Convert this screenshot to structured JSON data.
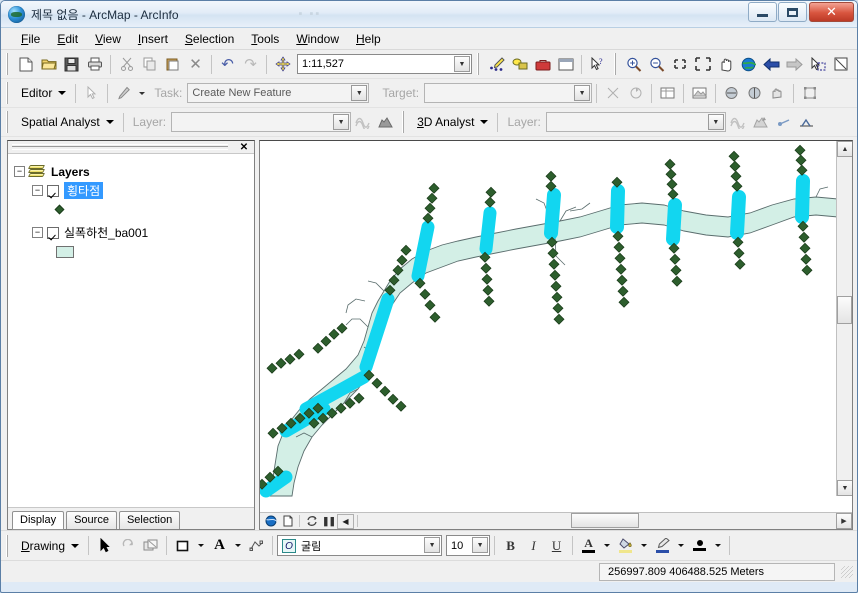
{
  "window": {
    "title": "제목 없음 - ArcMap - ArcInfo",
    "minimize_label": "Minimize",
    "maximize_label": "Maximize",
    "close_label": "✕"
  },
  "menubar": {
    "items": [
      {
        "label": "File",
        "accel": "F"
      },
      {
        "label": "Edit",
        "accel": "E"
      },
      {
        "label": "View",
        "accel": "V"
      },
      {
        "label": "Insert",
        "accel": "I"
      },
      {
        "label": "Selection",
        "accel": "S"
      },
      {
        "label": "Tools",
        "accel": "T"
      },
      {
        "label": "Window",
        "accel": "W"
      },
      {
        "label": "Help",
        "accel": "H"
      }
    ]
  },
  "standard_toolbar": {
    "scale_value": "1:11,527",
    "buttons": [
      {
        "name": "new-map-icon",
        "glyph": "🗋"
      },
      {
        "name": "open-map-icon",
        "glyph": "📂"
      },
      {
        "name": "save-map-icon",
        "glyph": "💾"
      },
      {
        "name": "print-icon",
        "glyph": "🖨"
      },
      {
        "name": "cut-icon",
        "glyph": "✂"
      },
      {
        "name": "copy-icon",
        "glyph": "⧉"
      },
      {
        "name": "paste-icon",
        "glyph": "📋"
      },
      {
        "name": "delete-icon",
        "glyph": "✕"
      },
      {
        "name": "undo-icon",
        "glyph": "↶"
      },
      {
        "name": "redo-icon",
        "glyph": "↷"
      },
      {
        "name": "add-data-icon",
        "glyph": "✜"
      }
    ],
    "right_buttons": [
      {
        "name": "editor-toolbar-icon",
        "glyph": "✎"
      },
      {
        "name": "model-builder-icon",
        "glyph": "⬟"
      },
      {
        "name": "toolbox-icon",
        "glyph": "🧰"
      },
      {
        "name": "command-line-icon",
        "glyph": "▭"
      },
      {
        "name": "whats-this-icon",
        "glyph": "↖?"
      },
      {
        "name": "zoom-in-icon",
        "glyph": "⊕"
      },
      {
        "name": "zoom-out-icon",
        "glyph": "⊖"
      },
      {
        "name": "fixed-zoom-in-icon",
        "glyph": "⤢"
      },
      {
        "name": "fixed-zoom-out-icon",
        "glyph": "⤡"
      },
      {
        "name": "pan-icon",
        "glyph": "✋"
      },
      {
        "name": "full-extent-icon",
        "glyph": "🌐"
      },
      {
        "name": "go-back-extent-icon",
        "glyph": "⬅"
      },
      {
        "name": "go-forward-extent-icon",
        "glyph": "➡"
      },
      {
        "name": "select-features-icon",
        "glyph": "↖"
      },
      {
        "name": "clear-selection-icon",
        "glyph": "⊠"
      }
    ]
  },
  "editor_toolbar": {
    "menu_label": "Editor",
    "task_label": "Task:",
    "task_value": "Create New Feature",
    "target_label": "Target:",
    "target_value": "",
    "buttons": [
      {
        "name": "edit-tool-icon",
        "glyph": "↖"
      },
      {
        "name": "sketch-tool-icon",
        "glyph": "✎"
      },
      {
        "name": "split-tool-icon",
        "glyph": "✂"
      },
      {
        "name": "rotate-tool-icon",
        "glyph": "⟳"
      },
      {
        "name": "attributes-icon",
        "glyph": "▤"
      },
      {
        "name": "sketch-properties-icon",
        "glyph": "◲"
      },
      {
        "name": "create-new-feature-icon",
        "glyph": "◉"
      },
      {
        "name": "edit-annotation-icon",
        "glyph": "◎"
      },
      {
        "name": "construct-features-icon",
        "glyph": "✍"
      },
      {
        "name": "topology-icon",
        "glyph": "⬚"
      }
    ]
  },
  "spatial_analyst_toolbar": {
    "menu_label": "Spatial Analyst",
    "layer_label": "Layer:",
    "layer_value": "",
    "buttons": [
      {
        "name": "histogram-icon",
        "glyph": "≋"
      },
      {
        "name": "surface-icon",
        "glyph": "◣"
      }
    ]
  },
  "analyst3d_toolbar": {
    "menu_label": "3D Analyst",
    "layer_label": "Layer:",
    "layer_value": "",
    "buttons": [
      {
        "name": "contour-icon",
        "glyph": "≋"
      },
      {
        "name": "steepest-path-icon",
        "glyph": "↘"
      },
      {
        "name": "line-of-sight-icon",
        "glyph": "👁"
      },
      {
        "name": "interpolate-line-icon",
        "glyph": "⟋"
      }
    ]
  },
  "toc": {
    "close_label": "✕",
    "root": "Layers",
    "layers": [
      {
        "name": "횡타점",
        "checked": true,
        "selected": true,
        "symbol": "point-diamond",
        "symbol_color": "#2d5e2d"
      },
      {
        "name": "실폭하천_ba001",
        "checked": true,
        "selected": false,
        "symbol": "polygon-fill",
        "symbol_color": "#d3efe6"
      }
    ],
    "tabs": [
      {
        "label": "Display",
        "active": true
      },
      {
        "label": "Source",
        "active": false
      },
      {
        "label": "Selection",
        "active": false
      }
    ]
  },
  "map": {
    "data_frame_controls": [
      {
        "name": "globe-view-icon",
        "glyph": "🌐"
      },
      {
        "name": "page-layout-view-icon",
        "glyph": "🗋"
      },
      {
        "name": "refresh-view-icon",
        "glyph": "↻"
      },
      {
        "name": "pause-drawing-icon",
        "glyph": "❚❚"
      },
      {
        "name": "resume-drawing-icon",
        "glyph": "◀"
      }
    ],
    "scroll_up_glyph": "▲",
    "scroll_down_glyph": "▼",
    "scroll_left_glyph": "◀",
    "scroll_right_glyph": "▶",
    "river_fill": "#d3efe6",
    "river_outline": "#5a6d6d",
    "cross_section_color": "#12d6f0",
    "point_color": "#2d5e2d"
  },
  "drawing_toolbar": {
    "menu_label": "Drawing",
    "font_name": "굴림",
    "font_size": "10",
    "bold_label": "B",
    "italic_label": "I",
    "underline_label": "U",
    "buttons": [
      {
        "name": "select-elements-icon",
        "glyph": "↖"
      },
      {
        "name": "rotate-element-icon",
        "glyph": "⟳"
      },
      {
        "name": "drawing-order-icon",
        "glyph": "▨"
      },
      {
        "name": "new-rectangle-icon",
        "glyph": "▭"
      },
      {
        "name": "new-text-icon",
        "glyph": "A"
      },
      {
        "name": "nudge-icon",
        "glyph": "⬚"
      },
      {
        "name": "font-color-icon",
        "glyph": "A"
      },
      {
        "name": "fill-color-icon",
        "glyph": "🎨"
      },
      {
        "name": "line-color-icon",
        "glyph": "✒"
      },
      {
        "name": "marker-color-icon",
        "glyph": "●"
      }
    ]
  },
  "statusbar": {
    "coordinates": "256997.809  406488.525 Meters"
  }
}
